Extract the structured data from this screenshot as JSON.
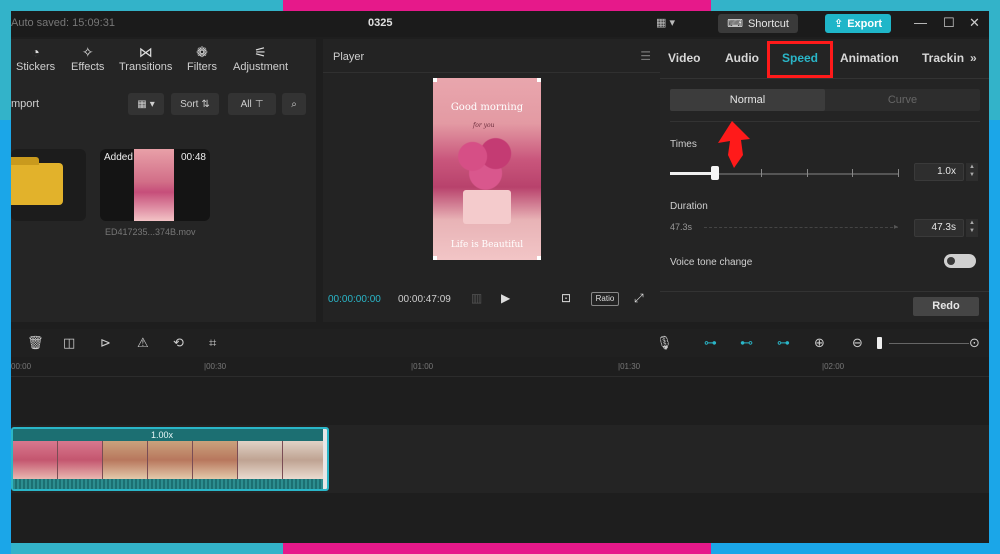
{
  "titlebar": {
    "autosave": "Auto saved: 15:09:31",
    "project": "0325",
    "layout_icon": "layout-icon",
    "shortcut_label": "Shortcut",
    "export_label": "Export"
  },
  "media_toolbar": {
    "items": [
      {
        "label": "Stickers",
        "icon": "sticker-icon"
      },
      {
        "label": "Effects",
        "icon": "effects-icon"
      },
      {
        "label": "Transitions",
        "icon": "transitions-icon"
      },
      {
        "label": "Filters",
        "icon": "filters-icon"
      },
      {
        "label": "Adjustment",
        "icon": "adjustment-icon"
      }
    ]
  },
  "media": {
    "import_label": "mport",
    "sort_label": "Sort",
    "all_label": "All",
    "tile": {
      "badge": "Added",
      "duration": "00:48",
      "filename": "ED417235...374B.mov"
    }
  },
  "player": {
    "title": "Player",
    "preview_text_top": "Good morning",
    "preview_text_mid": "for you",
    "preview_text_bottom": "Life is Beautiful",
    "current_time": "00:00:00:00",
    "total_time": "00:00:47:09",
    "ratio_label": "Ratio"
  },
  "props": {
    "tabs": [
      "Video",
      "Audio",
      "Speed",
      "Animation",
      "Trackin"
    ],
    "active_tab": "Speed",
    "segment": {
      "normal": "Normal",
      "curve": "Curve"
    },
    "times_label": "Times",
    "times_value": "1.0x",
    "times_slider_fraction": 0.2,
    "duration_label": "Duration",
    "duration_from": "47.3s",
    "duration_value": "47.3s",
    "voice_tone_label": "Voice tone change",
    "voice_tone_on": false,
    "redo_label": "Redo",
    "highlight_color": "#ff1a1a",
    "accent_color": "#2ab6c8"
  },
  "timeline": {
    "ruler": [
      "00:00",
      "|00:30",
      "|01:00",
      "|01:30",
      "|02:00"
    ],
    "clip_speed": "1.00x",
    "clip_color": "#1c6f72"
  },
  "frame_colors": {
    "cyan": "#33b3c9",
    "magenta": "#e6198a",
    "blue": "#1ba6e8"
  }
}
